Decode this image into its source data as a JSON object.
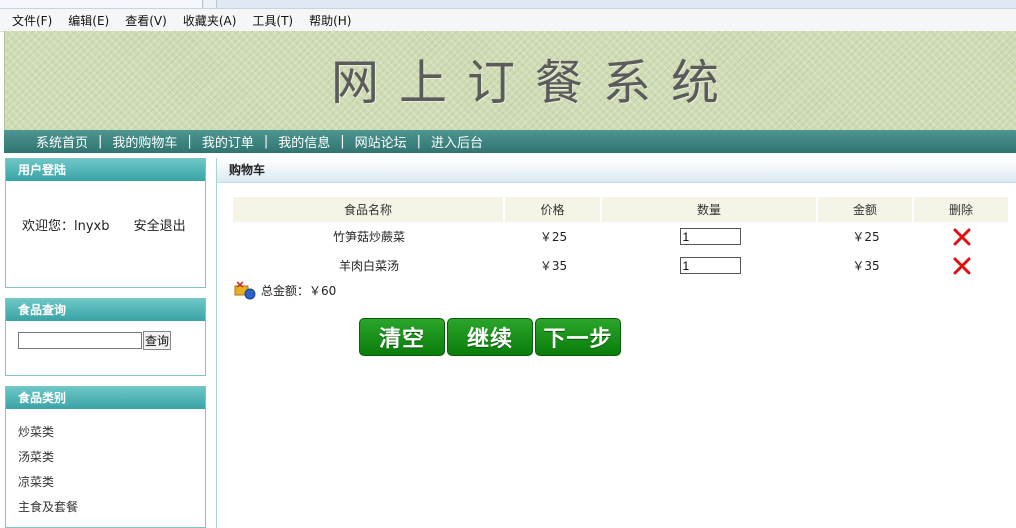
{
  "menu": [
    "文件(F)",
    "编辑(E)",
    "查看(V)",
    "收藏夹(A)",
    "工具(T)",
    "帮助(H)"
  ],
  "banner": {
    "title": "网上订餐系统"
  },
  "nav": [
    "系统首页",
    "我的购物车",
    "我的订单",
    "我的信息",
    "网站论坛",
    "进入后台"
  ],
  "nav_separator": "|",
  "login": {
    "title": "用户登陆",
    "welcome": "欢迎您：lnyxb",
    "logout": "安全退出"
  },
  "search": {
    "title": "食品查询",
    "value": "",
    "button": "查询"
  },
  "categories": {
    "title": "食品类别",
    "items": [
      "炒菜类",
      "汤菜类",
      "凉菜类",
      "主食及套餐"
    ]
  },
  "cart": {
    "title": "购物车",
    "headers": [
      "食品名称",
      "价格",
      "数量",
      "金额",
      "删除"
    ],
    "rows": [
      {
        "name": "竹笋菇炒蕨菜",
        "price": "￥25",
        "qty": "1",
        "amount": "￥25"
      },
      {
        "name": "羊肉白菜汤",
        "price": "￥35",
        "qty": "1",
        "amount": "￥35"
      }
    ],
    "total": "总金额：￥60",
    "buttons": {
      "clear": "清空",
      "continue": "继续",
      "next": "下一步"
    }
  },
  "colors": {
    "nav_bg": "#2f7470",
    "side_header": "#39a3a6",
    "button_green": "#0a7d0a",
    "delete_red": "#e01010"
  }
}
